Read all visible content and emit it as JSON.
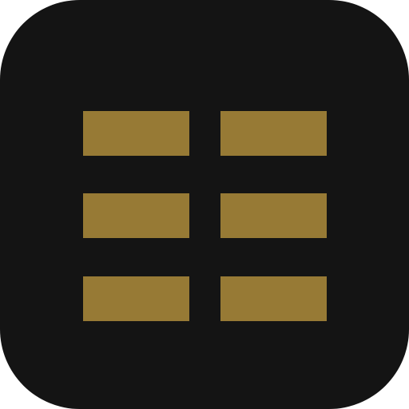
{
  "icon": {
    "name": "grid-icon",
    "background_color": "#141414",
    "bar_color": "#977A35",
    "rows": 3,
    "columns": 2
  }
}
